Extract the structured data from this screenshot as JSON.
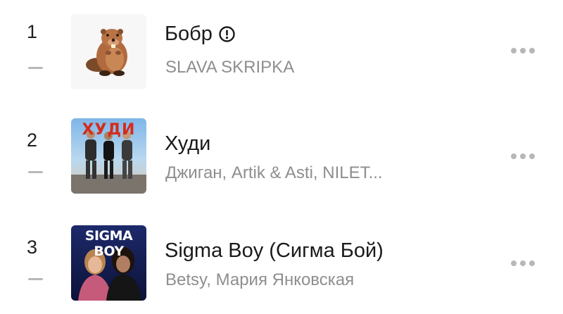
{
  "tracks": [
    {
      "rank": "1",
      "title": "Бобр",
      "explicit": true,
      "artist": "SLAVA SKRIPKA",
      "cover_icon": "beaver-emoji"
    },
    {
      "rank": "2",
      "title": "Худи",
      "explicit": false,
      "artist": "Джиган, Artik & Asti, NILET...",
      "cover_text": "ХУДИ",
      "cover_icon": "album-cover-hudi"
    },
    {
      "rank": "3",
      "title": "Sigma Boy (Сигма Бой)",
      "explicit": false,
      "artist": "Betsy, Мария Янковская",
      "cover_text": "SIGMA BOY",
      "cover_icon": "album-cover-sigma-boy"
    }
  ],
  "colors": {
    "title": "#1a1a1a",
    "artist": "#8e8e8e",
    "dash": "#b8b8b8",
    "dots": "#b7b7b7"
  },
  "icons": {
    "explicit": "explicit-exclamation-icon",
    "more": "more-dots-icon",
    "trend": "trend-unchanged-dash-icon"
  }
}
